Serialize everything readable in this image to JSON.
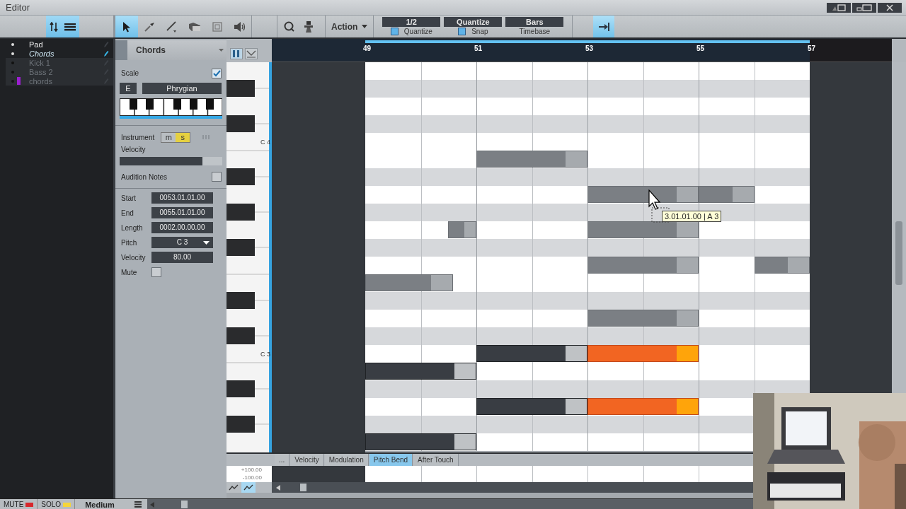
{
  "window": {
    "title": "Editor"
  },
  "view_toggle": {
    "on": true
  },
  "tools": [
    {
      "kind": "arrow",
      "selected": true
    },
    {
      "kind": "pipette",
      "selected": false
    },
    {
      "kind": "line",
      "selected": false
    },
    {
      "kind": "eraser",
      "selected": false
    },
    {
      "kind": "frame",
      "selected": false
    },
    {
      "kind": "speaker",
      "selected": false
    }
  ],
  "action_menu": {
    "label": "Action"
  },
  "quantize_settings": [
    {
      "value": "1/2",
      "label": "Quantize",
      "kind": "toggle",
      "on": true
    },
    {
      "value": "Quantize",
      "label": "Snap",
      "kind": "toggle",
      "on": true
    },
    {
      "value": "Bars",
      "label": "Timebase",
      "kind": "plain"
    }
  ],
  "follow_button": {
    "on": true
  },
  "tracks": [
    {
      "name": "Pad",
      "active": true,
      "selected": false
    },
    {
      "name": "Chords",
      "active": true,
      "selected": true
    },
    {
      "name": "Kick 1",
      "active": false,
      "selected": false
    },
    {
      "name": "Bass 2",
      "active": false,
      "selected": false
    },
    {
      "name": "chords",
      "active": false,
      "selected": false,
      "color": "#9b1fd0"
    }
  ],
  "inspector": {
    "track": "Chords",
    "scale": {
      "label": "Scale",
      "checked": true,
      "root": "E",
      "mode": "Phrygian"
    },
    "instrument": {
      "label": "Instrument",
      "buttons": [
        {
          "label": "m",
          "on": false
        },
        {
          "label": "s",
          "on": true
        }
      ]
    },
    "velocity": {
      "label": "Velocity",
      "level": 0.81
    },
    "audition": {
      "label": "Audition Notes",
      "checked": false
    },
    "fields": [
      {
        "label": "Start",
        "value": "0053.01.01.00",
        "kind": "text"
      },
      {
        "label": "End",
        "value": "0055.01.01.00",
        "kind": "text"
      },
      {
        "label": "Length",
        "value": "0002.00.00.00",
        "kind": "text"
      },
      {
        "label": "Pitch",
        "value": "C 3",
        "kind": "dropdown"
      },
      {
        "label": "Velocity",
        "value": "80.00",
        "kind": "text"
      },
      {
        "label": "Mute",
        "kind": "checkbox",
        "checked": false
      }
    ]
  },
  "ruler": {
    "bars": [
      "49",
      "51",
      "53",
      "55",
      "57"
    ]
  },
  "piano": {
    "octave_labels": [
      "C 4",
      "C 3"
    ]
  },
  "notes": [
    {
      "kind": "ghost",
      "selected": false
    },
    {
      "kind": "ghost",
      "selected": false
    },
    {
      "kind": "ghost",
      "selected": false
    },
    {
      "kind": "ghost",
      "selected": false
    },
    {
      "kind": "ghost",
      "selected": false
    },
    {
      "kind": "ghost",
      "selected": false
    },
    {
      "kind": "ghost",
      "selected": false
    },
    {
      "kind": "ghost",
      "selected": false
    },
    {
      "kind": "ghost",
      "selected": false
    },
    {
      "kind": "note",
      "selected": false
    },
    {
      "kind": "note",
      "selected": true
    },
    {
      "kind": "note",
      "selected": false
    },
    {
      "kind": "note",
      "selected": false
    },
    {
      "kind": "note",
      "selected": true
    },
    {
      "kind": "note",
      "selected": false
    }
  ],
  "tooltip": "3.01.01.00 | A 3",
  "automation": {
    "tabs": [
      {
        "label": "...",
        "selected": false
      },
      {
        "label": "Velocity",
        "selected": false
      },
      {
        "label": "Modulation",
        "selected": false
      },
      {
        "label": "Pitch Bend",
        "selected": true
      },
      {
        "label": "After Touch",
        "selected": false
      }
    ],
    "range": [
      "+100.00",
      "-100.00"
    ],
    "modes": [
      {
        "selected": false
      },
      {
        "selected": true
      }
    ]
  },
  "footer": {
    "mute": "MUTE",
    "solo": "SOLO",
    "zoom": "Medium"
  }
}
